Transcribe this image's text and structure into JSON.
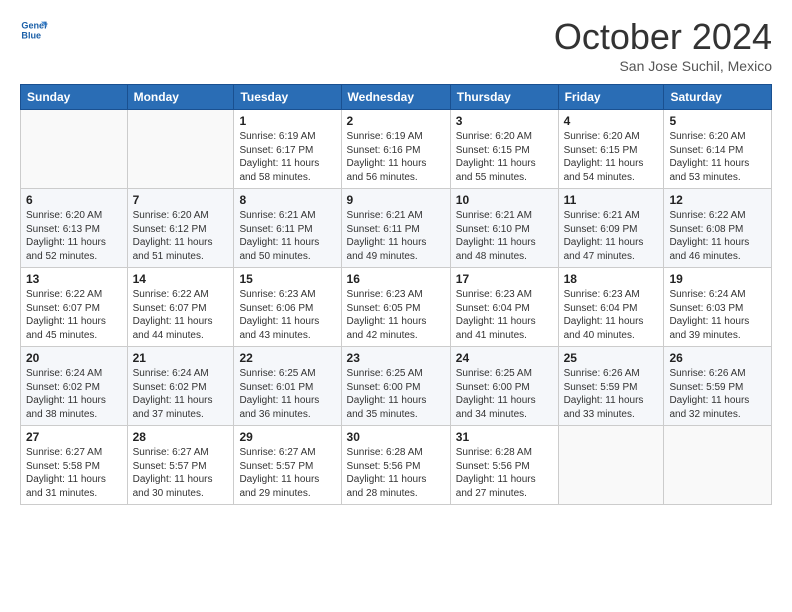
{
  "logo": {
    "line1": "General",
    "line2": "Blue"
  },
  "title": "October 2024",
  "location": "San Jose Suchil, Mexico",
  "days_header": [
    "Sunday",
    "Monday",
    "Tuesday",
    "Wednesday",
    "Thursday",
    "Friday",
    "Saturday"
  ],
  "weeks": [
    [
      {
        "day": "",
        "sunrise": "",
        "sunset": "",
        "daylight": ""
      },
      {
        "day": "",
        "sunrise": "",
        "sunset": "",
        "daylight": ""
      },
      {
        "day": "1",
        "sunrise": "Sunrise: 6:19 AM",
        "sunset": "Sunset: 6:17 PM",
        "daylight": "Daylight: 11 hours and 58 minutes."
      },
      {
        "day": "2",
        "sunrise": "Sunrise: 6:19 AM",
        "sunset": "Sunset: 6:16 PM",
        "daylight": "Daylight: 11 hours and 56 minutes."
      },
      {
        "day": "3",
        "sunrise": "Sunrise: 6:20 AM",
        "sunset": "Sunset: 6:15 PM",
        "daylight": "Daylight: 11 hours and 55 minutes."
      },
      {
        "day": "4",
        "sunrise": "Sunrise: 6:20 AM",
        "sunset": "Sunset: 6:15 PM",
        "daylight": "Daylight: 11 hours and 54 minutes."
      },
      {
        "day": "5",
        "sunrise": "Sunrise: 6:20 AM",
        "sunset": "Sunset: 6:14 PM",
        "daylight": "Daylight: 11 hours and 53 minutes."
      }
    ],
    [
      {
        "day": "6",
        "sunrise": "Sunrise: 6:20 AM",
        "sunset": "Sunset: 6:13 PM",
        "daylight": "Daylight: 11 hours and 52 minutes."
      },
      {
        "day": "7",
        "sunrise": "Sunrise: 6:20 AM",
        "sunset": "Sunset: 6:12 PM",
        "daylight": "Daylight: 11 hours and 51 minutes."
      },
      {
        "day": "8",
        "sunrise": "Sunrise: 6:21 AM",
        "sunset": "Sunset: 6:11 PM",
        "daylight": "Daylight: 11 hours and 50 minutes."
      },
      {
        "day": "9",
        "sunrise": "Sunrise: 6:21 AM",
        "sunset": "Sunset: 6:11 PM",
        "daylight": "Daylight: 11 hours and 49 minutes."
      },
      {
        "day": "10",
        "sunrise": "Sunrise: 6:21 AM",
        "sunset": "Sunset: 6:10 PM",
        "daylight": "Daylight: 11 hours and 48 minutes."
      },
      {
        "day": "11",
        "sunrise": "Sunrise: 6:21 AM",
        "sunset": "Sunset: 6:09 PM",
        "daylight": "Daylight: 11 hours and 47 minutes."
      },
      {
        "day": "12",
        "sunrise": "Sunrise: 6:22 AM",
        "sunset": "Sunset: 6:08 PM",
        "daylight": "Daylight: 11 hours and 46 minutes."
      }
    ],
    [
      {
        "day": "13",
        "sunrise": "Sunrise: 6:22 AM",
        "sunset": "Sunset: 6:07 PM",
        "daylight": "Daylight: 11 hours and 45 minutes."
      },
      {
        "day": "14",
        "sunrise": "Sunrise: 6:22 AM",
        "sunset": "Sunset: 6:07 PM",
        "daylight": "Daylight: 11 hours and 44 minutes."
      },
      {
        "day": "15",
        "sunrise": "Sunrise: 6:23 AM",
        "sunset": "Sunset: 6:06 PM",
        "daylight": "Daylight: 11 hours and 43 minutes."
      },
      {
        "day": "16",
        "sunrise": "Sunrise: 6:23 AM",
        "sunset": "Sunset: 6:05 PM",
        "daylight": "Daylight: 11 hours and 42 minutes."
      },
      {
        "day": "17",
        "sunrise": "Sunrise: 6:23 AM",
        "sunset": "Sunset: 6:04 PM",
        "daylight": "Daylight: 11 hours and 41 minutes."
      },
      {
        "day": "18",
        "sunrise": "Sunrise: 6:23 AM",
        "sunset": "Sunset: 6:04 PM",
        "daylight": "Daylight: 11 hours and 40 minutes."
      },
      {
        "day": "19",
        "sunrise": "Sunrise: 6:24 AM",
        "sunset": "Sunset: 6:03 PM",
        "daylight": "Daylight: 11 hours and 39 minutes."
      }
    ],
    [
      {
        "day": "20",
        "sunrise": "Sunrise: 6:24 AM",
        "sunset": "Sunset: 6:02 PM",
        "daylight": "Daylight: 11 hours and 38 minutes."
      },
      {
        "day": "21",
        "sunrise": "Sunrise: 6:24 AM",
        "sunset": "Sunset: 6:02 PM",
        "daylight": "Daylight: 11 hours and 37 minutes."
      },
      {
        "day": "22",
        "sunrise": "Sunrise: 6:25 AM",
        "sunset": "Sunset: 6:01 PM",
        "daylight": "Daylight: 11 hours and 36 minutes."
      },
      {
        "day": "23",
        "sunrise": "Sunrise: 6:25 AM",
        "sunset": "Sunset: 6:00 PM",
        "daylight": "Daylight: 11 hours and 35 minutes."
      },
      {
        "day": "24",
        "sunrise": "Sunrise: 6:25 AM",
        "sunset": "Sunset: 6:00 PM",
        "daylight": "Daylight: 11 hours and 34 minutes."
      },
      {
        "day": "25",
        "sunrise": "Sunrise: 6:26 AM",
        "sunset": "Sunset: 5:59 PM",
        "daylight": "Daylight: 11 hours and 33 minutes."
      },
      {
        "day": "26",
        "sunrise": "Sunrise: 6:26 AM",
        "sunset": "Sunset: 5:59 PM",
        "daylight": "Daylight: 11 hours and 32 minutes."
      }
    ],
    [
      {
        "day": "27",
        "sunrise": "Sunrise: 6:27 AM",
        "sunset": "Sunset: 5:58 PM",
        "daylight": "Daylight: 11 hours and 31 minutes."
      },
      {
        "day": "28",
        "sunrise": "Sunrise: 6:27 AM",
        "sunset": "Sunset: 5:57 PM",
        "daylight": "Daylight: 11 hours and 30 minutes."
      },
      {
        "day": "29",
        "sunrise": "Sunrise: 6:27 AM",
        "sunset": "Sunset: 5:57 PM",
        "daylight": "Daylight: 11 hours and 29 minutes."
      },
      {
        "day": "30",
        "sunrise": "Sunrise: 6:28 AM",
        "sunset": "Sunset: 5:56 PM",
        "daylight": "Daylight: 11 hours and 28 minutes."
      },
      {
        "day": "31",
        "sunrise": "Sunrise: 6:28 AM",
        "sunset": "Sunset: 5:56 PM",
        "daylight": "Daylight: 11 hours and 27 minutes."
      },
      {
        "day": "",
        "sunrise": "",
        "sunset": "",
        "daylight": ""
      },
      {
        "day": "",
        "sunrise": "",
        "sunset": "",
        "daylight": ""
      }
    ]
  ]
}
